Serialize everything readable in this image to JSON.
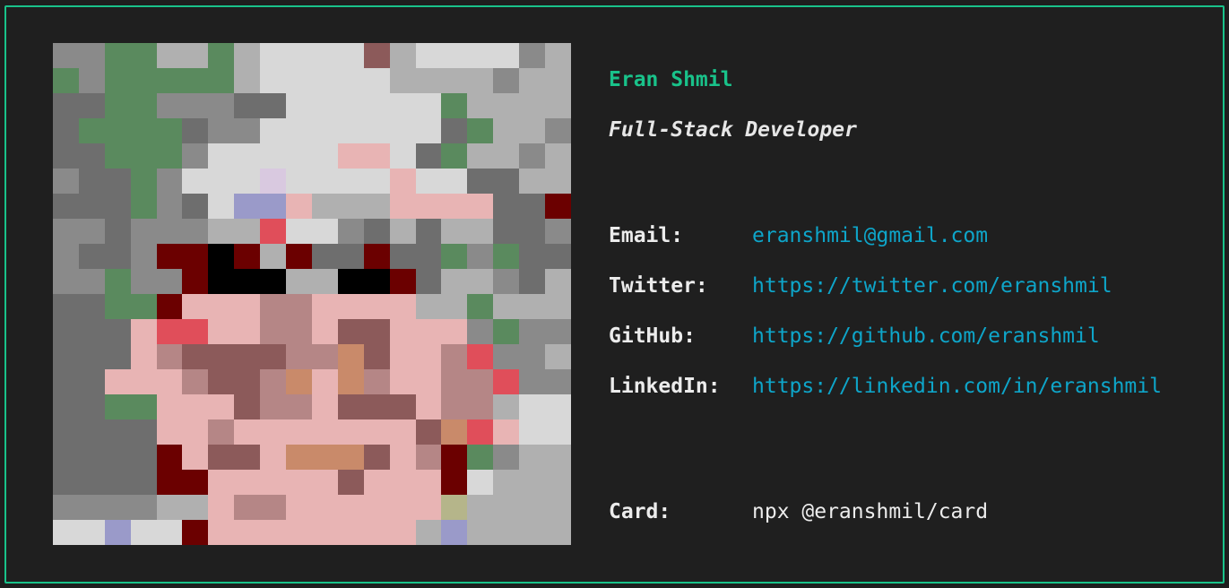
{
  "profile": {
    "name": "Eran Shmil",
    "role": "Full-Stack Developer"
  },
  "contacts": [
    {
      "label": "Email:",
      "value": "eranshmil@gmail.com"
    },
    {
      "label": "Twitter:",
      "value": "https://twitter.com/eranshmil"
    },
    {
      "label": "GitHub:",
      "value": "https://github.com/eranshmil"
    },
    {
      "label": "LinkedIn:",
      "value": "https://linkedin.com/in/eranshmil"
    }
  ],
  "card": {
    "label": "Card:",
    "value": "npx @eranshmil/card"
  },
  "colors": {
    "accent": "#19c28a",
    "link": "#0ea5c9",
    "background": "#1f1f1f"
  },
  "avatar": {
    "description_icon": "pixel-art-portrait",
    "palette": [
      "#5a8a5e",
      "#8a8a8a",
      "#6e6e6e",
      "#b0b0b0",
      "#d8d8d8",
      "#e8b4b4",
      "#b58686",
      "#8c5a5a",
      "#b5b58a",
      "#c98a6a",
      "#000000",
      "#6b0000",
      "#9a9ac9",
      "#e04e5a",
      "#4d8f85",
      "#d9c9e0"
    ],
    "pixels": [
      "11003303444473444413",
      "01000003444443333133",
      "22001112244444403333",
      "20000211444444420331",
      "22000144444554203313",
      "12201444f44445442233",
      "2220124cc5333555522b",
      "11211133d44123233221",
      "1221bbab3b22b2201022",
      "11011baaa33aab233123",
      "2200b555665555330333",
      "2225dd55665775551011",
      "2225677776697556d113",
      "22555677695965566d11",
      "22005557665777566344",
      "2222556555555579d544",
      "2222b5775999756b0133",
      "2222bb555557555b4333",
      "11113356655555583333",
      "44c44b555555553c3333"
    ]
  }
}
